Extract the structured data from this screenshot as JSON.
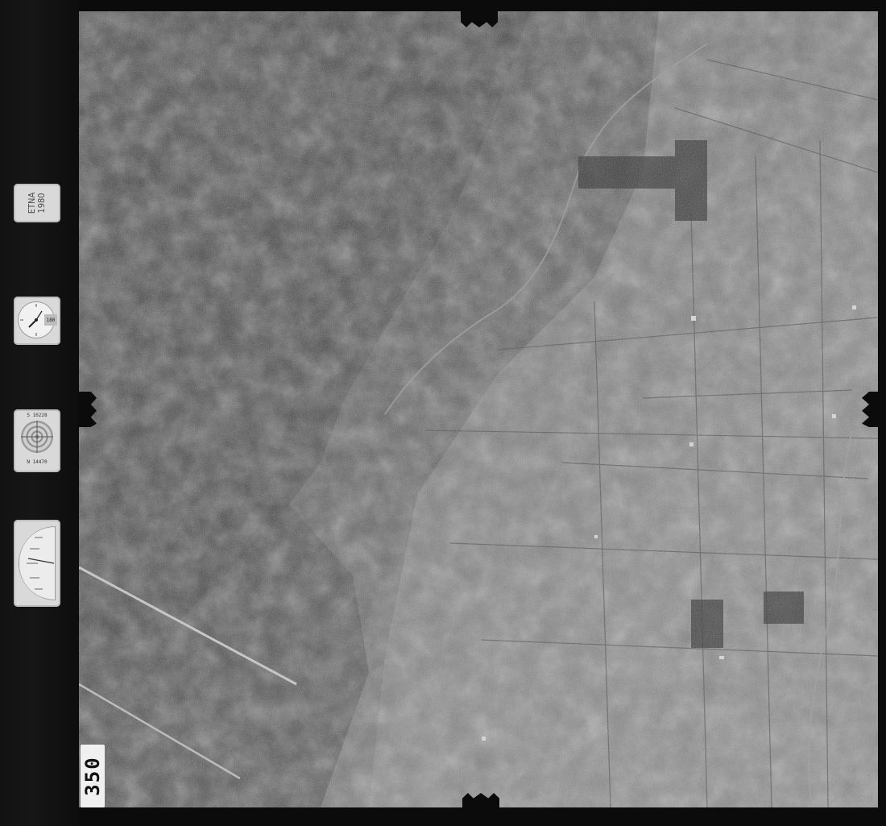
{
  "film_frame": {
    "label_card_text": "ETNA\n1980",
    "frame_number": "350",
    "clock_counter": "180",
    "compass_top_text": "S 10228",
    "compass_bottom_text": "N 14470"
  },
  "photo": {
    "content": "aerial-terrain"
  },
  "colors": {
    "frame": "#0b0b0b",
    "photo_mid": "#6a6a6a",
    "instrument_card": "#d9d9d9"
  }
}
